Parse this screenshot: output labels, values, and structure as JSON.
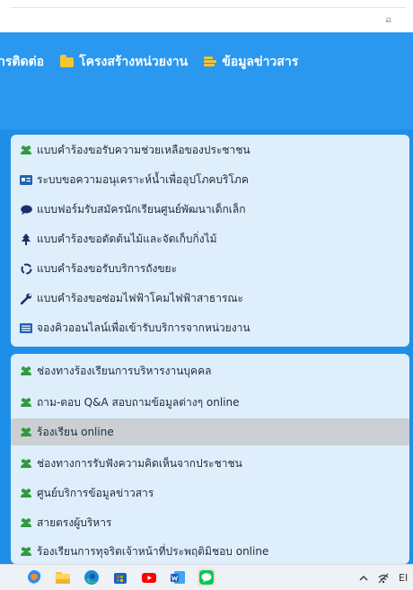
{
  "browser": {
    "top_glyph": "ລ"
  },
  "nav": {
    "items": [
      {
        "label": "ารติดต่อ"
      },
      {
        "label": "โครงสร้างหน่วยงาน",
        "icon": "folder-icon"
      },
      {
        "label": "ข้อมูลข่าวสาร",
        "icon": "newspaper-icon"
      }
    ]
  },
  "panel1": {
    "items": [
      {
        "label": "แบบคำร้องขอรับความช่วยเหลือของประชาชน",
        "icon": "users-icon"
      },
      {
        "label": "ระบบขอความอนุเคราะห์น้ำเพื่ออุปโภคบริโภค",
        "icon": "id-card-icon"
      },
      {
        "label": "แบบฟอร์มรับสมัครนักเรียนศูนย์พัฒนาเด็กเล็ก",
        "icon": "chat-bubble-icon"
      },
      {
        "label": "แบบคำร้องขอตัดต้นไม้และจัดเก็บกิ่งไม้",
        "icon": "tree-icon"
      },
      {
        "label": "แบบคำร้องขอรับบริการถังขยะ",
        "icon": "recycle-icon"
      },
      {
        "label": "แบบคำร้องขอซ่อมไฟฟ้าโคมไฟฟ้าสาธารณะ",
        "icon": "wrench-icon"
      },
      {
        "label": "จองคิวออนไลน์เพื่อเข้ารับบริการจากหน่วยงาน",
        "icon": "list-icon"
      }
    ]
  },
  "panel2": {
    "items": [
      {
        "label": "ช่องทางร้องเรียนการบริหารงานบุคคล",
        "icon": "users-icon"
      },
      {
        "label": "ถาม-ตอบ Q&A สอบถามข้อมูลต่างๆ online",
        "icon": "users-icon"
      },
      {
        "label": "ร้องเรียน online",
        "icon": "users-icon",
        "active": true
      },
      {
        "label": "ช่องทางการรับฟังความคิดเห็นจากประชาชน",
        "icon": "users-icon"
      },
      {
        "label": "ศูนย์บริการข้อมูลข่าวสาร",
        "icon": "users-icon"
      },
      {
        "label": "สายตรงผู้บริหาร",
        "icon": "users-icon"
      },
      {
        "label": "ร้องเรียนการทุจริตเจ้าหน้าที่ประพฤติมิชอบ online",
        "icon": "users-icon"
      }
    ]
  },
  "taskbar": {
    "apps": [
      "copilot-icon",
      "file-explorer-icon",
      "edge-icon",
      "store-icon",
      "youtube-icon",
      "word-icon",
      "line-icon"
    ],
    "tray_text": "EI"
  },
  "colors": {
    "header_blue": "#2a98ef",
    "panel_bg": "#deeefb",
    "active_row": "#cbcfd3",
    "users_icon_green": "#2e9b3d",
    "folder_yellow": "#f7c62f"
  }
}
